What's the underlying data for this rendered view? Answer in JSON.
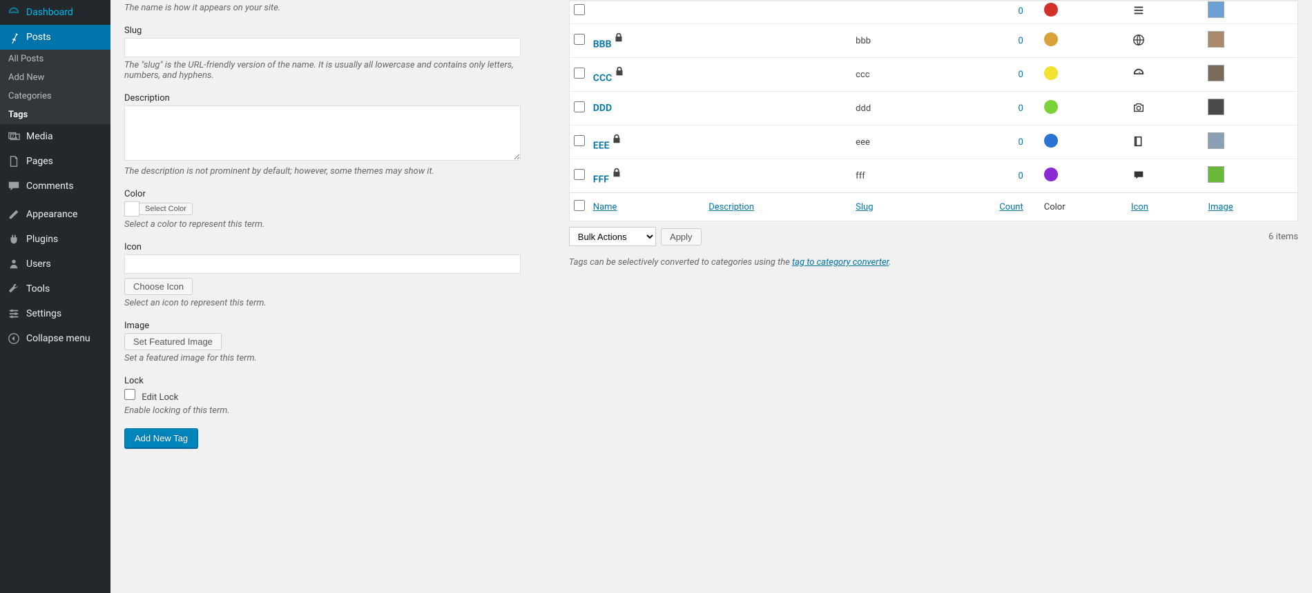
{
  "sidebar": {
    "items": [
      {
        "id": "dashboard",
        "label": "Dashboard",
        "icon": "dashboard"
      },
      {
        "id": "posts",
        "label": "Posts",
        "icon": "pin",
        "current": true,
        "submenu": [
          {
            "id": "all-posts",
            "label": "All Posts"
          },
          {
            "id": "add-new",
            "label": "Add New"
          },
          {
            "id": "categories",
            "label": "Categories"
          },
          {
            "id": "tags",
            "label": "Tags",
            "current": true
          }
        ]
      },
      {
        "id": "media",
        "label": "Media",
        "icon": "media"
      },
      {
        "id": "pages",
        "label": "Pages",
        "icon": "pages"
      },
      {
        "id": "comments",
        "label": "Comments",
        "icon": "comments"
      },
      {
        "sep": true
      },
      {
        "id": "appearance",
        "label": "Appearance",
        "icon": "appearance"
      },
      {
        "id": "plugins",
        "label": "Plugins",
        "icon": "plugins"
      },
      {
        "id": "users",
        "label": "Users",
        "icon": "users"
      },
      {
        "id": "tools",
        "label": "Tools",
        "icon": "tools"
      },
      {
        "id": "settings",
        "label": "Settings",
        "icon": "settings"
      },
      {
        "id": "collapse",
        "label": "Collapse menu",
        "icon": "collapse"
      }
    ]
  },
  "form": {
    "name_desc": "The name is how it appears on your site.",
    "slug_label": "Slug",
    "slug_desc": "The \"slug\" is the URL-friendly version of the name. It is usually all lowercase and contains only letters, numbers, and hyphens.",
    "description_label": "Description",
    "description_desc": "The description is not prominent by default; however, some themes may show it.",
    "color_label": "Color",
    "color_button": "Select Color",
    "color_desc": "Select a color to represent this term.",
    "icon_label": "Icon",
    "icon_button": "Choose Icon",
    "icon_desc": "Select an icon to represent this term.",
    "image_label": "Image",
    "image_button": "Set Featured Image",
    "image_desc": "Set a featured image for this term.",
    "lock_label": "Lock",
    "lock_checkbox": "Edit Lock",
    "lock_desc": "Enable locking of this term.",
    "submit": "Add New Tag"
  },
  "table": {
    "columns": {
      "name": "Name",
      "description": "Description",
      "slug": "Slug",
      "count": "Count",
      "color": "Color",
      "icon": "Icon",
      "image": "Image"
    },
    "rows": [
      {
        "name": "BBB",
        "locked": true,
        "slug": "bbb",
        "count": "0",
        "color": "#d8a23a",
        "icon": "globe",
        "thumb": "#a88a6a"
      },
      {
        "name": "CCC",
        "locked": true,
        "slug": "ccc",
        "count": "0",
        "color": "#f2e230",
        "icon": "dashboard",
        "thumb": "#7a6a5a"
      },
      {
        "name": "DDD",
        "locked": false,
        "slug": "ddd",
        "count": "0",
        "color": "#7ad13a",
        "icon": "camera",
        "thumb": "#4a4a4a"
      },
      {
        "name": "EEE",
        "locked": true,
        "slug": "eee",
        "count": "0",
        "color": "#2a72d4",
        "icon": "book",
        "thumb": "#8aa0b5"
      },
      {
        "name": "FFF",
        "locked": true,
        "slug": "fff",
        "count": "0",
        "color": "#8a2ad4",
        "icon": "chat",
        "thumb": "#6ab83a"
      }
    ],
    "first_row_partial": {
      "count": "0",
      "color": "#d4302a",
      "icon": "list",
      "thumb": "#6aa0d4"
    }
  },
  "bulk": {
    "label": "Bulk Actions",
    "apply": "Apply",
    "items": "6 items"
  },
  "convert": {
    "prefix": "Tags can be selectively converted to categories using the ",
    "link": "tag to category converter",
    "suffix": "."
  }
}
